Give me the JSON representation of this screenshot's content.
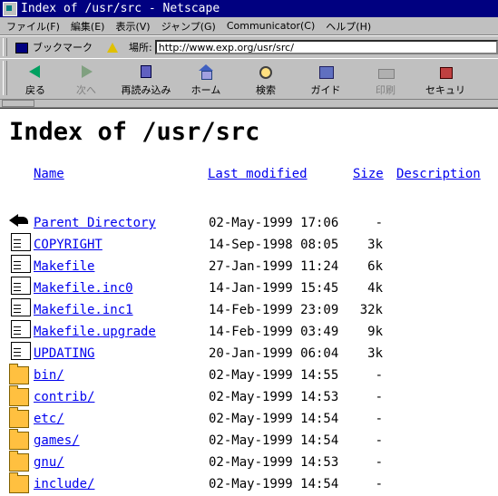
{
  "window": {
    "title": "Index of /usr/src - Netscape"
  },
  "menu": [
    "ファイル(F)",
    "編集(E)",
    "表示(V)",
    "ジャンプ(G)",
    "Communicator(C)",
    "ヘルプ(H)"
  ],
  "location": {
    "bookmarks_label": "ブックマーク",
    "location_label": "場所:",
    "url": "http://www.exp.org/usr/src/"
  },
  "toolbar": {
    "back": "戻る",
    "forward": "次へ",
    "reload": "再読み込み",
    "home": "ホーム",
    "search": "検索",
    "guide": "ガイド",
    "print": "印刷",
    "security": "セキュリ"
  },
  "page": {
    "title": "Index of /usr/src",
    "headers": {
      "name": "Name",
      "modified": "Last modified",
      "size": "Size",
      "description": "Description"
    },
    "entries": [
      {
        "name": "Parent Directory",
        "modified": "02-May-1999 17:06",
        "size": "-",
        "icon": "parent-dir-icon"
      },
      {
        "name": "COPYRIGHT",
        "modified": "14-Sep-1998 08:05",
        "size": "3k",
        "icon": "text-file-icon"
      },
      {
        "name": "Makefile",
        "modified": "27-Jan-1999 11:24",
        "size": "6k",
        "icon": "text-file-icon"
      },
      {
        "name": "Makefile.inc0",
        "modified": "14-Jan-1999 15:45",
        "size": "4k",
        "icon": "text-file-icon"
      },
      {
        "name": "Makefile.inc1",
        "modified": "14-Feb-1999 23:09",
        "size": "32k",
        "icon": "text-file-icon"
      },
      {
        "name": "Makefile.upgrade",
        "modified": "14-Feb-1999 03:49",
        "size": "9k",
        "icon": "text-file-icon"
      },
      {
        "name": "UPDATING",
        "modified": "20-Jan-1999 06:04",
        "size": "3k",
        "icon": "text-file-icon"
      },
      {
        "name": "bin/",
        "modified": "02-May-1999 14:55",
        "size": "-",
        "icon": "folder-icon"
      },
      {
        "name": "contrib/",
        "modified": "02-May-1999 14:53",
        "size": "-",
        "icon": "folder-icon"
      },
      {
        "name": "etc/",
        "modified": "02-May-1999 14:54",
        "size": "-",
        "icon": "folder-icon"
      },
      {
        "name": "games/",
        "modified": "02-May-1999 14:54",
        "size": "-",
        "icon": "folder-icon"
      },
      {
        "name": "gnu/",
        "modified": "02-May-1999 14:53",
        "size": "-",
        "icon": "folder-icon"
      },
      {
        "name": "include/",
        "modified": "02-May-1999 14:54",
        "size": "-",
        "icon": "folder-icon"
      }
    ]
  },
  "colors": {
    "link": "#0000ee",
    "titlebar": "#000080",
    "chrome": "#c0c0c0"
  }
}
